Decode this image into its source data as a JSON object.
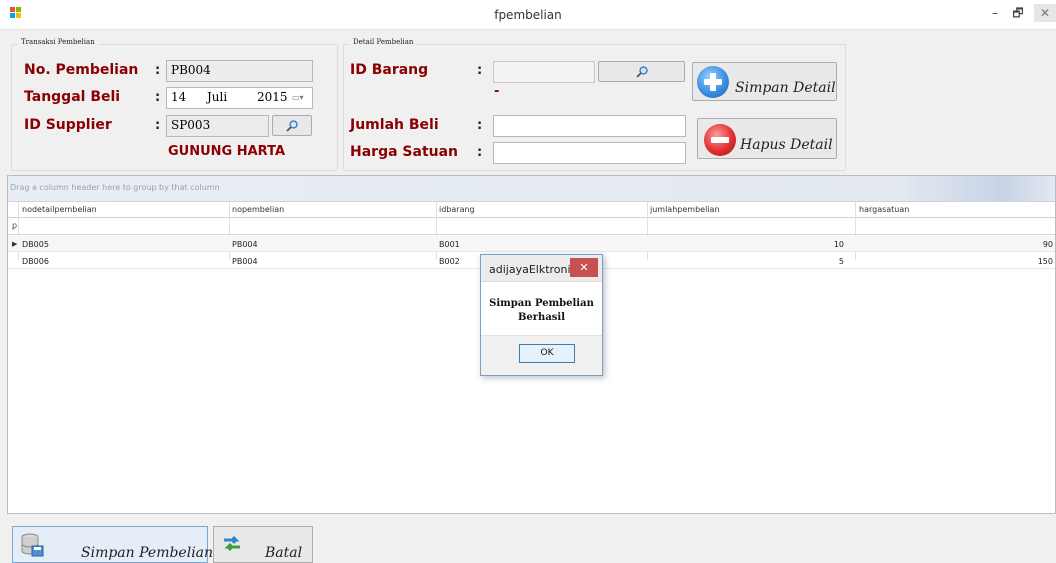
{
  "window": {
    "title": "fpembelian",
    "minimize_glyph": "–",
    "restore_glyph": "🗗",
    "close_glyph": "✕"
  },
  "transaksi": {
    "caption": "Transaksi Pembelian",
    "no_pembelian_label": "No. Pembelian",
    "no_pembelian_value": "PB004",
    "tanggal_label": "Tanggal Beli",
    "tanggal_day": "14",
    "tanggal_month": "Juli",
    "tanggal_year": "2015",
    "supplier_label": "ID Supplier",
    "supplier_value": "SP003",
    "supplier_name": "GUNUNG HARTA",
    "colon": ":"
  },
  "detail": {
    "caption": "Detail Pembelian",
    "id_barang_label": "ID Barang",
    "id_barang_value": "",
    "barang_name": "-",
    "jumlah_label": "Jumlah Beli",
    "jumlah_value": "",
    "harga_label": "Harga Satuan",
    "harga_value": "",
    "colon": ":"
  },
  "buttons": {
    "simpan_detail": "Simpan Detail",
    "hapus_detail": "Hapus Detail",
    "simpan_pembelian": "Simpan Pembelian",
    "batal": "Batal"
  },
  "grid": {
    "group_hint": "Drag a column header here to group by that column",
    "columns": [
      "nodetailpembelian",
      "nopembelian",
      "idbarang",
      "jumlahpembelian",
      "hargasatuan"
    ],
    "rows": [
      [
        "DB005",
        "PB004",
        "B001",
        "10",
        "90"
      ],
      [
        "DB006",
        "PB004",
        "B002",
        "5",
        "150"
      ]
    ]
  },
  "message_box": {
    "title": "adijayaElktronik",
    "text_line1": "Simpan Pembelian",
    "text_line2": "Berhasil",
    "ok_label": "OK",
    "close_glyph": "✕"
  },
  "colors": {
    "label_red": "#8b0000",
    "msg_close": "#c75050"
  },
  "icons": [
    "app-icon",
    "search-icon",
    "calendar-dropdown-icon",
    "plus-circle-icon",
    "minus-circle-icon",
    "database-save-icon",
    "refresh-arrows-icon",
    "filter-icon",
    "row-indicator-icon"
  ]
}
